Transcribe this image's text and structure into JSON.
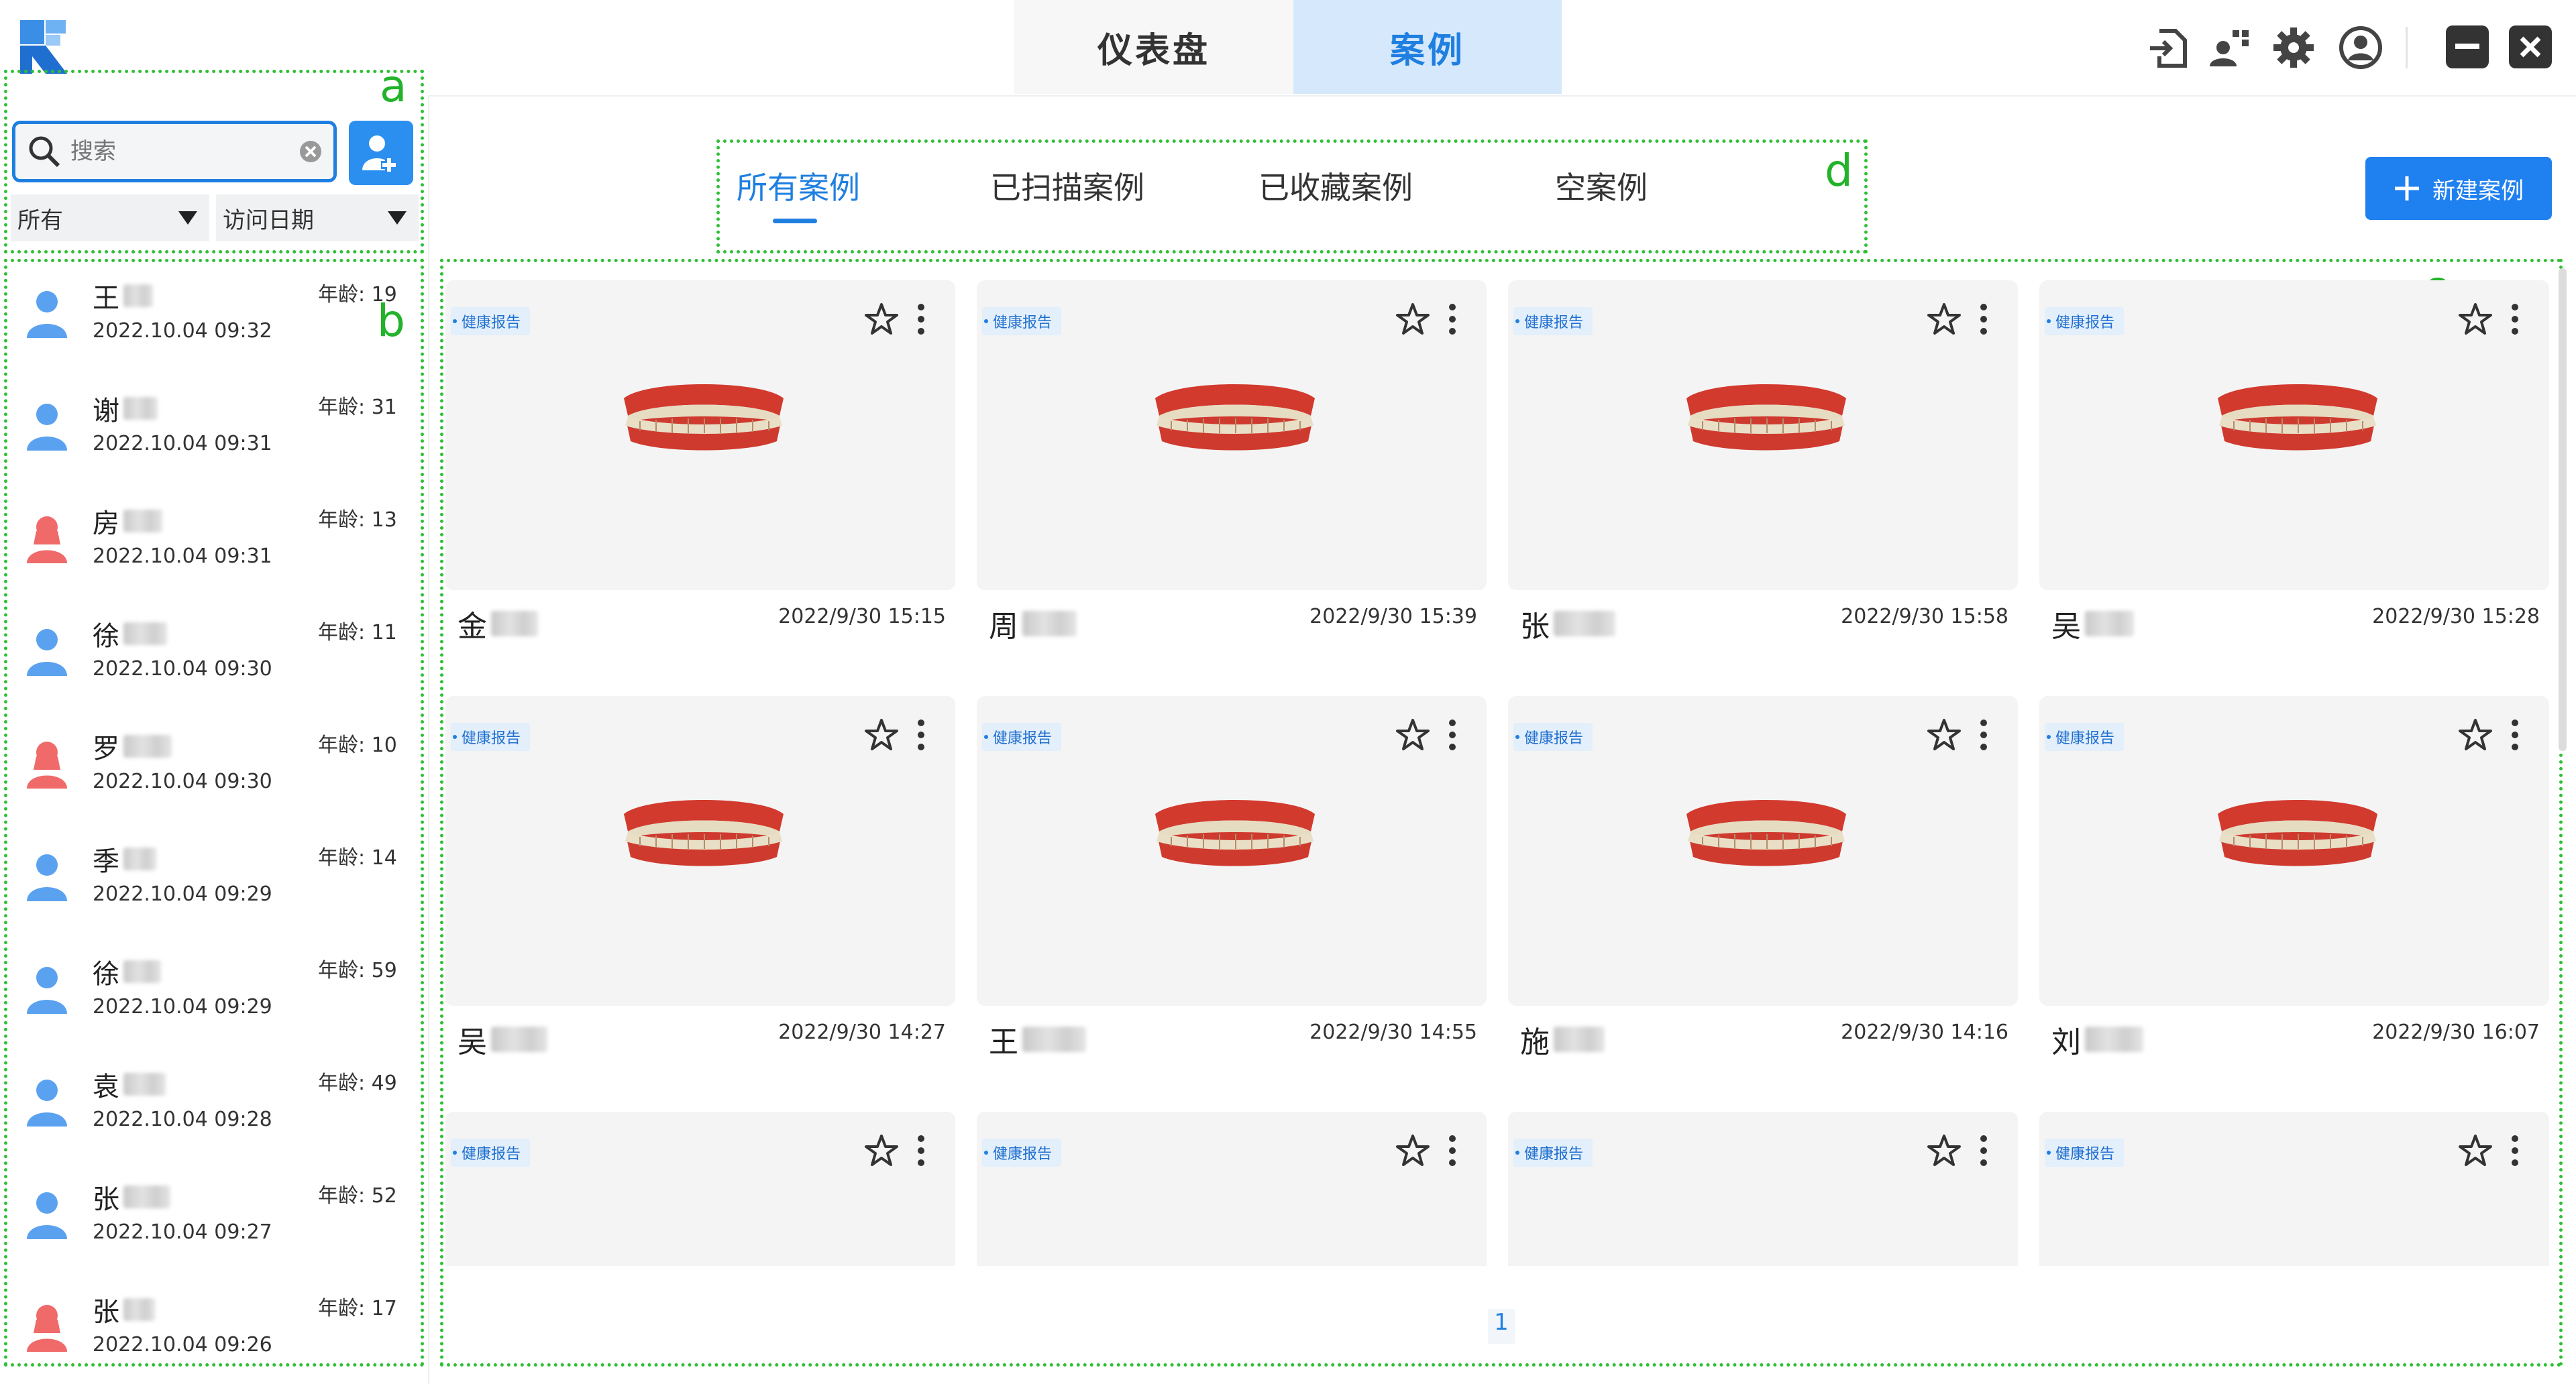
{
  "header": {
    "tabs": [
      {
        "label": "仪表盘",
        "active": false
      },
      {
        "label": "案例",
        "active": true
      }
    ],
    "icons": [
      "import-icon",
      "users-icon",
      "settings-gear-icon",
      "account-icon",
      "minimize-icon",
      "close-icon"
    ]
  },
  "sidebar": {
    "search": {
      "placeholder": "搜索"
    },
    "filter": {
      "category": "所有",
      "sort": "访问日期"
    },
    "patients": [
      {
        "name": "王",
        "age_label": "年龄: 19",
        "date": "2022.10.04 09:32",
        "gender": "male"
      },
      {
        "name": "谢",
        "age_label": "年龄: 31",
        "date": "2022.10.04 09:31",
        "gender": "male"
      },
      {
        "name": "房",
        "age_label": "年龄: 13",
        "date": "2022.10.04 09:31",
        "gender": "female"
      },
      {
        "name": "徐",
        "age_label": "年龄: 11",
        "date": "2022.10.04 09:30",
        "gender": "male"
      },
      {
        "name": "罗",
        "age_label": "年龄: 10",
        "date": "2022.10.04 09:30",
        "gender": "female"
      },
      {
        "name": "季",
        "age_label": "年龄: 14",
        "date": "2022.10.04 09:29",
        "gender": "male"
      },
      {
        "name": "徐",
        "age_label": "年龄: 59",
        "date": "2022.10.04 09:29",
        "gender": "male"
      },
      {
        "name": "袁",
        "age_label": "年龄: 49",
        "date": "2022.10.04 09:28",
        "gender": "male"
      },
      {
        "name": "张",
        "age_label": "年龄: 52",
        "date": "2022.10.04 09:27",
        "gender": "male"
      },
      {
        "name": "张",
        "age_label": "年龄: 17",
        "date": "2022.10.04 09:26",
        "gender": "female"
      }
    ]
  },
  "main": {
    "tabs": [
      {
        "label": "所有案例",
        "active": true
      },
      {
        "label": "已扫描案例",
        "active": false
      },
      {
        "label": "已收藏案例",
        "active": false
      },
      {
        "label": "空案例",
        "active": false
      }
    ],
    "new_case_label": "新建案例",
    "cases": [
      {
        "tag": "健康报告",
        "name": "金",
        "date": "2022/9/30 15:15"
      },
      {
        "tag": "健康报告",
        "name": "周",
        "date": "2022/9/30 15:39"
      },
      {
        "tag": "健康报告",
        "name": "张",
        "date": "2022/9/30 15:58"
      },
      {
        "tag": "健康报告",
        "name": "吴",
        "date": "2022/9/30 15:28"
      },
      {
        "tag": "健康报告",
        "name": "吴",
        "date": "2022/9/30 14:27"
      },
      {
        "tag": "健康报告",
        "name": "王",
        "date": "2022/9/30 14:55"
      },
      {
        "tag": "健康报告",
        "name": "施",
        "date": "2022/9/30 14:16"
      },
      {
        "tag": "健康报告",
        "name": "刘",
        "date": "2022/9/30 16:07"
      },
      {
        "tag": "健康报告",
        "name": "",
        "date": ""
      },
      {
        "tag": "健康报告",
        "name": "",
        "date": ""
      },
      {
        "tag": "健康报告",
        "name": "",
        "date": ""
      },
      {
        "tag": "健康报告",
        "name": "",
        "date": ""
      }
    ],
    "pagination": {
      "current_page": "1"
    }
  },
  "annotations": [
    "a",
    "b",
    "c",
    "d"
  ],
  "colors": {
    "accent": "#1f7fe0",
    "annotation": "#2fbf36",
    "male_icon": "#5aa2f0",
    "female_icon": "#f06a6a"
  }
}
